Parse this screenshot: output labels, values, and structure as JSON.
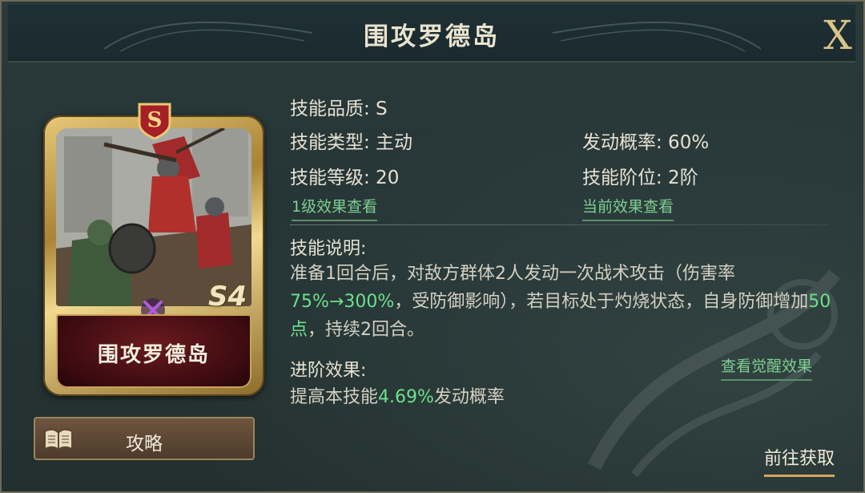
{
  "header": {
    "title": "围攻罗德岛",
    "close_label": "X"
  },
  "card": {
    "grade_letter": "S",
    "level_tag": "S4",
    "name": "围攻罗德岛",
    "type_icon": "crossed-swords-icon",
    "frame_color": "#c9a356",
    "name_bg_color": "#4a0d12"
  },
  "guide_button": {
    "label": "攻略",
    "icon": "book-icon"
  },
  "info": {
    "quality": "技能品质: S",
    "type": "技能类型: 主动",
    "level": "技能等级: 20",
    "trigger_rate": "发动概率: 60%",
    "rank": "技能阶位: 2阶",
    "level1_link": "1级效果查看",
    "current_link": "当前效果查看"
  },
  "description": {
    "title": "技能说明:",
    "part1": "准备1回合后，对敌方群体2人发动一次战术攻击（伤害率",
    "hl1": "75%→300%",
    "part2": "，受防御影响），若目标处于灼烧状态，自身防御增加",
    "hl2": "50点",
    "part3": "，持续2回合。"
  },
  "advance": {
    "title": "进阶效果:",
    "awaken_link": "查看觉醒效果",
    "desc_prefix": "提高本技能",
    "desc_value": "4.69%",
    "desc_suffix": "发动概率"
  },
  "goto_button": {
    "label": "前往获取"
  },
  "colors": {
    "accent_green": "#6de08d",
    "link_green": "#7fcf92",
    "gold": "#cfa75a",
    "panel_bg": "#263536"
  }
}
